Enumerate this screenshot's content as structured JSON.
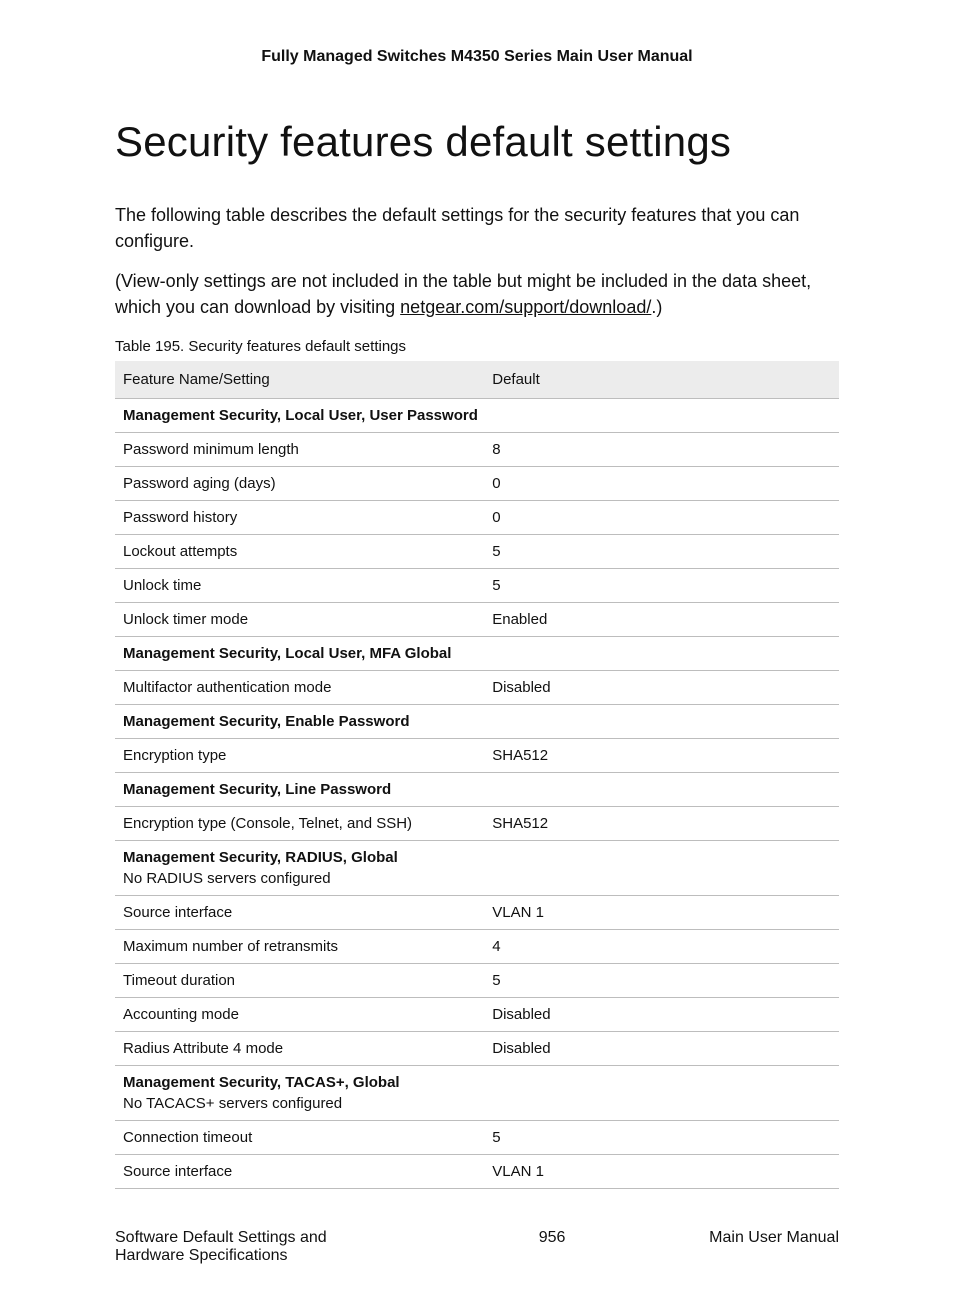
{
  "header": "Fully Managed Switches M4350 Series Main User Manual",
  "title": "Security features default settings",
  "intro": "The following table describes the default settings for the security features that you can configure.",
  "note_prefix": "(View-only settings are not included in the table but might be included in the data sheet, which you can download by visiting ",
  "note_link_text": "netgear.com/support/download/",
  "note_suffix": ".)",
  "table_caption": "Table 195. Security features default settings",
  "columns": {
    "feature": "Feature Name/Setting",
    "default": "Default"
  },
  "rows": [
    {
      "type": "group",
      "label": "Management Security, Local User, User Password"
    },
    {
      "type": "row",
      "feature": "Password minimum length",
      "default": "8"
    },
    {
      "type": "row",
      "feature": "Password aging (days)",
      "default": "0"
    },
    {
      "type": "row",
      "feature": "Password history",
      "default": "0"
    },
    {
      "type": "row",
      "feature": "Lockout attempts",
      "default": "5"
    },
    {
      "type": "row",
      "feature": "Unlock time",
      "default": "5"
    },
    {
      "type": "row",
      "feature": "Unlock timer mode",
      "default": "Enabled"
    },
    {
      "type": "group",
      "label": "Management Security, Local User, MFA Global"
    },
    {
      "type": "row",
      "feature": "Multifactor authentication mode",
      "default": "Disabled"
    },
    {
      "type": "group",
      "label": "Management Security, Enable Password"
    },
    {
      "type": "row",
      "feature": "Encryption type",
      "default": "SHA512"
    },
    {
      "type": "group",
      "label": "Management Security, Line Password"
    },
    {
      "type": "row",
      "feature": "Encryption type (Console, Telnet, and SSH)",
      "default": "SHA512"
    },
    {
      "type": "group",
      "label": "Management Security, RADIUS, Global",
      "subtext": "No RADIUS servers configured"
    },
    {
      "type": "row",
      "feature": "Source interface",
      "default": "VLAN 1"
    },
    {
      "type": "row",
      "feature": "Maximum number of retransmits",
      "default": "4"
    },
    {
      "type": "row",
      "feature": "Timeout duration",
      "default": "5"
    },
    {
      "type": "row",
      "feature": "Accounting mode",
      "default": "Disabled"
    },
    {
      "type": "row",
      "feature": "Radius Attribute 4 mode",
      "default": "Disabled"
    },
    {
      "type": "group",
      "label": "Management Security, TACAS+, Global",
      "subtext": "No TACACS+ servers configured"
    },
    {
      "type": "row",
      "feature": "Connection timeout",
      "default": "5"
    },
    {
      "type": "row",
      "feature": "Source interface",
      "default": "VLAN 1"
    }
  ],
  "footer": {
    "left": "Software Default Settings and Hardware Specifications",
    "center": "956",
    "right": "Main User Manual"
  }
}
